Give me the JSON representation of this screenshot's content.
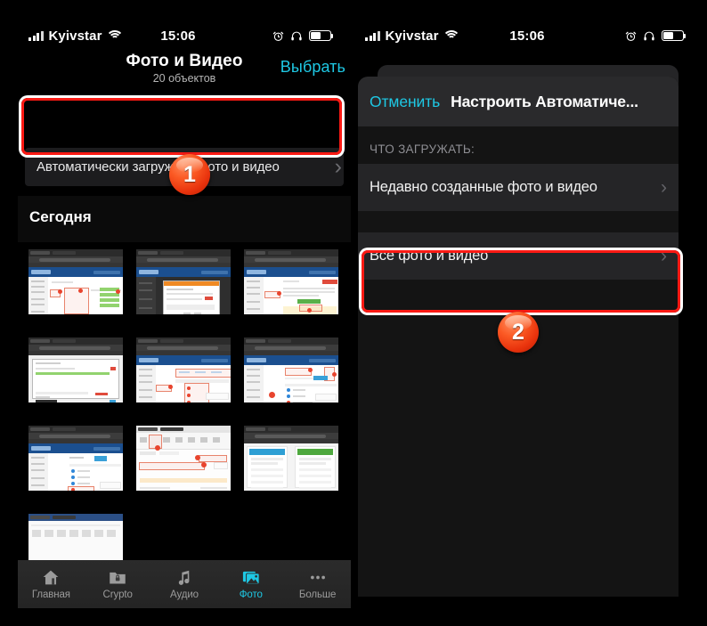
{
  "status_bar": {
    "carrier": "Kyivstar",
    "time": "15:06",
    "icons": [
      "signal-bars-icon",
      "wifi-icon",
      "alarm-clock-icon",
      "headphones-icon",
      "battery-icon"
    ]
  },
  "left_phone": {
    "nav": {
      "title": "Фото и Видео",
      "subtitle": "20 объектов",
      "select_button": "Выбрать"
    },
    "auto_upload_row": {
      "label": "Автоматически загружать фото и видео",
      "chevron": "›"
    },
    "section_header": "Сегодня",
    "tabbar": [
      {
        "label": "Главная",
        "icon": "home-icon",
        "active": false
      },
      {
        "label": "Crypto",
        "icon": "lock-folder-icon",
        "active": false
      },
      {
        "label": "Аудио",
        "icon": "music-note-icon",
        "active": false
      },
      {
        "label": "Фото",
        "icon": "photos-icon",
        "active": true
      },
      {
        "label": "Больше",
        "icon": "ellipsis-icon",
        "active": false
      }
    ]
  },
  "right_phone": {
    "sheet": {
      "cancel_button": "Отменить",
      "title": "Настроить Автоматиче...",
      "section_header": "ЧТО ЗАГРУЖАТЬ:",
      "rows": [
        {
          "label": "Недавно созданные фото и видео",
          "chevron": "›",
          "highlighted": false
        },
        {
          "label": "Все фото и видео",
          "chevron": "›",
          "highlighted": true
        }
      ]
    }
  },
  "annotations": {
    "badges": [
      {
        "number": "1"
      },
      {
        "number": "2"
      }
    ],
    "highlight_color": "#fb1a14",
    "accent_color": "#1ec8e4",
    "badge_color": "#e8320c"
  }
}
